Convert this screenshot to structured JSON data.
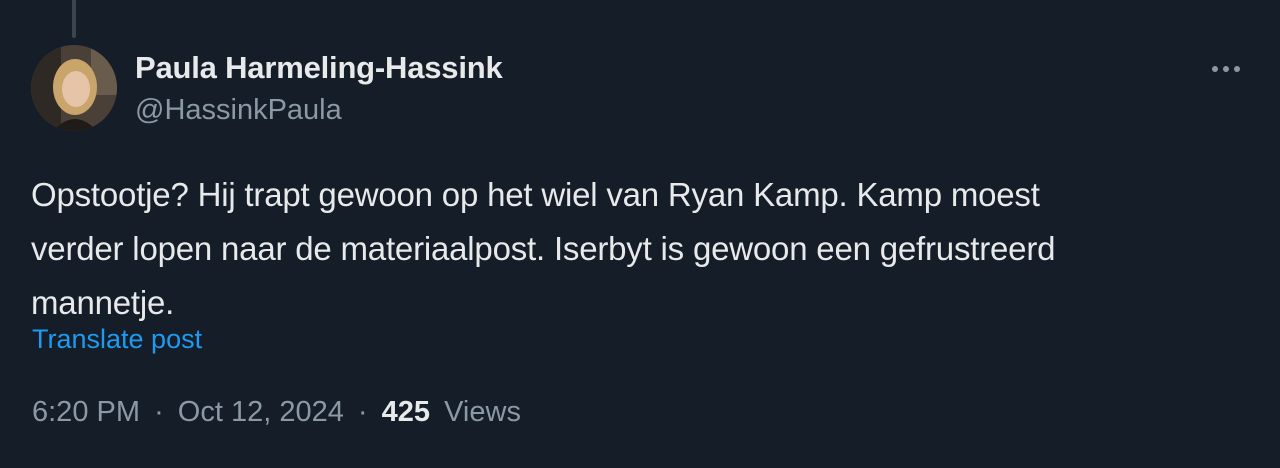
{
  "author": {
    "display_name": "Paula Harmeling-Hassink",
    "handle": "@HassinkPaula"
  },
  "tweet": {
    "lines": [
      "Opstootje? Hij trapt gewoon op het wiel van Ryan Kamp. Kamp moest",
      "verder lopen naar de materiaalpost. Iserbyt is gewoon een gefrustreerd",
      "mannetje."
    ],
    "translate_label": "Translate post"
  },
  "meta": {
    "time": "6:20 PM",
    "separator": "·",
    "date": "Oct 12, 2024",
    "views_count": "425",
    "views_label": "Views"
  },
  "icons": {
    "more": "more-horizontal-icon"
  },
  "colors": {
    "background": "#151d28",
    "primary_text": "#e7e9ea",
    "secondary_text": "#8b98a5",
    "link": "#1d9bf0"
  }
}
